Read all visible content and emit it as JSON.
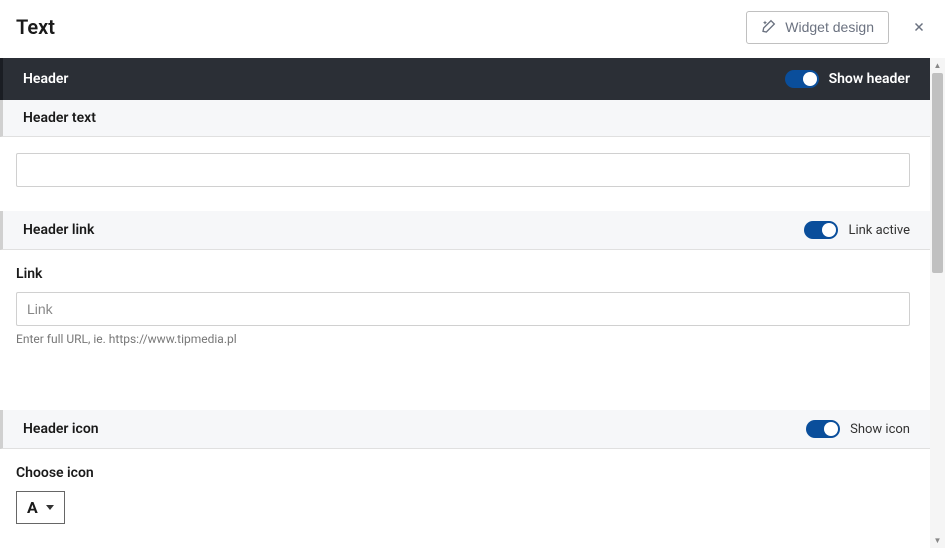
{
  "top": {
    "title": "Text",
    "widget_design_label": "Widget design"
  },
  "sections": {
    "header": {
      "title": "Header",
      "toggle_label": "Show header"
    },
    "header_text": {
      "title": "Header text",
      "value": ""
    },
    "header_link": {
      "title": "Header link",
      "toggle_label": "Link active",
      "field_label": "Link",
      "placeholder": "Link",
      "value": "",
      "hint": "Enter full URL, ie. https://www.tipmedia.pl"
    },
    "header_icon": {
      "title": "Header icon",
      "toggle_label": "Show icon",
      "choose_label": "Choose icon",
      "selected_glyph": "A"
    }
  }
}
